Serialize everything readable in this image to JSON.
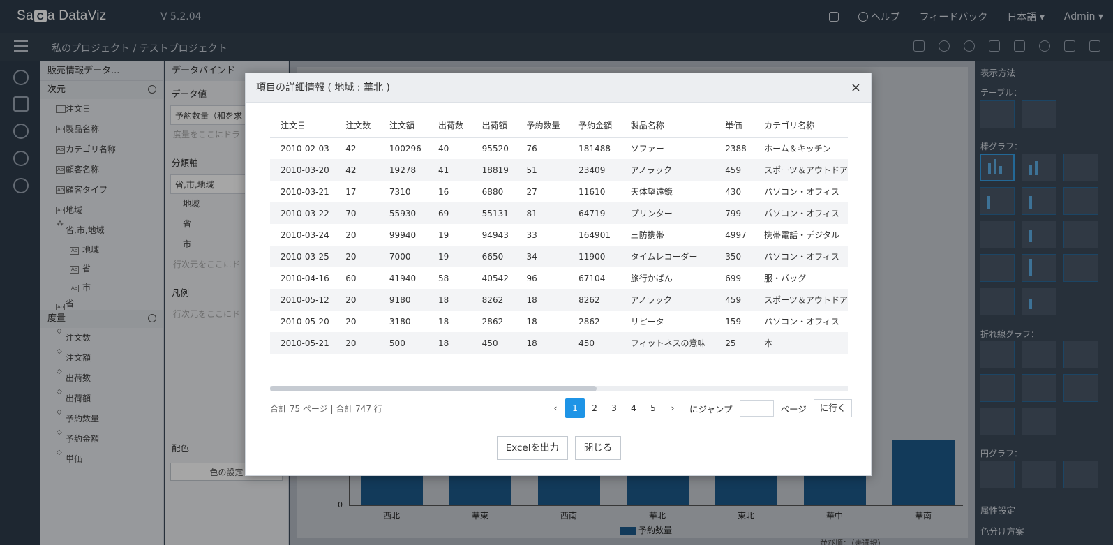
{
  "app": {
    "logo": "Sa",
    "logo_c": "C",
    "logo_tail": "a DataViz",
    "version": "V 5.2.04"
  },
  "topmenu": {
    "help": "ヘルプ",
    "feedback": "フィードバック",
    "language": "日本語 ▾",
    "user": "Admin ▾"
  },
  "breadcrumb": "私のプロジェクト  /  テストプロジェクト",
  "panel1": {
    "title": "販売情報データ...",
    "dimension_header": "次元",
    "dimensions": [
      "注文日",
      "製品名称",
      "カテゴリ名称",
      "顧客名称",
      "顧客タイプ",
      "地域",
      "省,市,地域"
    ],
    "hier_children": [
      "地域",
      "省",
      "市"
    ],
    "extra_dim": "省",
    "measure_header": "度量",
    "measures": [
      "注文数",
      "注文額",
      "出荷数",
      "出荷額",
      "予約数量",
      "予約金額",
      "単価"
    ]
  },
  "panel2": {
    "title": "データバインド",
    "data_value": "データ値",
    "data_value_item": "予約数量（和を求",
    "drop_measure": "度量をここにドラ",
    "category_axis": "分類軸",
    "category_item": "省,市,地域",
    "category_children": [
      "地域",
      "省",
      "市"
    ],
    "drop_dim": "行次元をここにド",
    "legend": "凡例",
    "drop_legend": "行次元をここにド",
    "color_section": "配色",
    "color_button": "色の設定"
  },
  "chart": {
    "categories": [
      "西北",
      "華東",
      "西南",
      "華北",
      "東北",
      "華中",
      "華南"
    ],
    "zero_label": "0",
    "legend": "予約数量",
    "footer_hint": "並び順：（未選択）"
  },
  "rightpanel": {
    "display_method": "表示方法",
    "table": "テーブル：",
    "bar": "棒グラフ：",
    "line": "折れ線グラフ：",
    "pie": "円グラフ：",
    "attributes": "属性設定",
    "color_scheme": "色分け方案"
  },
  "modal": {
    "title": "項目の詳細情報 ( 地域 : 華北 )",
    "close": "×",
    "columns": [
      "注文日",
      "注文数",
      "注文額",
      "出荷数",
      "出荷額",
      "予約数量",
      "予約金額",
      "製品名称",
      "単価",
      "カテゴリ名称"
    ],
    "rows": [
      [
        "2010-02-03",
        "42",
        "100296",
        "40",
        "95520",
        "76",
        "181488",
        "ソファー",
        "2388",
        "ホーム＆キッチン"
      ],
      [
        "2010-03-20",
        "42",
        "19278",
        "41",
        "18819",
        "51",
        "23409",
        "アノラック",
        "459",
        "スポーツ＆アウトドア"
      ],
      [
        "2010-03-21",
        "17",
        "7310",
        "16",
        "6880",
        "27",
        "11610",
        "天体望遠鏡",
        "430",
        "パソコン・オフィス"
      ],
      [
        "2010-03-22",
        "70",
        "55930",
        "69",
        "55131",
        "81",
        "64719",
        "プリンター",
        "799",
        "パソコン・オフィス"
      ],
      [
        "2010-03-24",
        "20",
        "99940",
        "19",
        "94943",
        "33",
        "164901",
        "三防携帯",
        "4997",
        "携帯電話・デジタル"
      ],
      [
        "2010-03-25",
        "20",
        "7000",
        "19",
        "6650",
        "34",
        "11900",
        "タイムレコーダー",
        "350",
        "パソコン・オフィス"
      ],
      [
        "2010-04-16",
        "60",
        "41940",
        "58",
        "40542",
        "96",
        "67104",
        "旅行かばん",
        "699",
        "服・バッグ"
      ],
      [
        "2010-05-12",
        "20",
        "9180",
        "18",
        "8262",
        "18",
        "8262",
        "アノラック",
        "459",
        "スポーツ＆アウトドア"
      ],
      [
        "2010-05-20",
        "20",
        "3180",
        "18",
        "2862",
        "18",
        "2862",
        "リピータ",
        "159",
        "パソコン・オフィス"
      ],
      [
        "2010-05-21",
        "20",
        "500",
        "18",
        "450",
        "18",
        "450",
        "フィットネスの意味",
        "25",
        "本"
      ]
    ],
    "total": "合計 75 ページ | 合計 747 行",
    "pager": {
      "prev": "‹",
      "pages": [
        "1",
        "2",
        "3",
        "4",
        "5"
      ],
      "next": "›",
      "jump_label": "にジャンプ",
      "page_label": "ページ",
      "go": "に行く"
    },
    "export_button": "Excelを出力",
    "close_button": "閉じる"
  }
}
